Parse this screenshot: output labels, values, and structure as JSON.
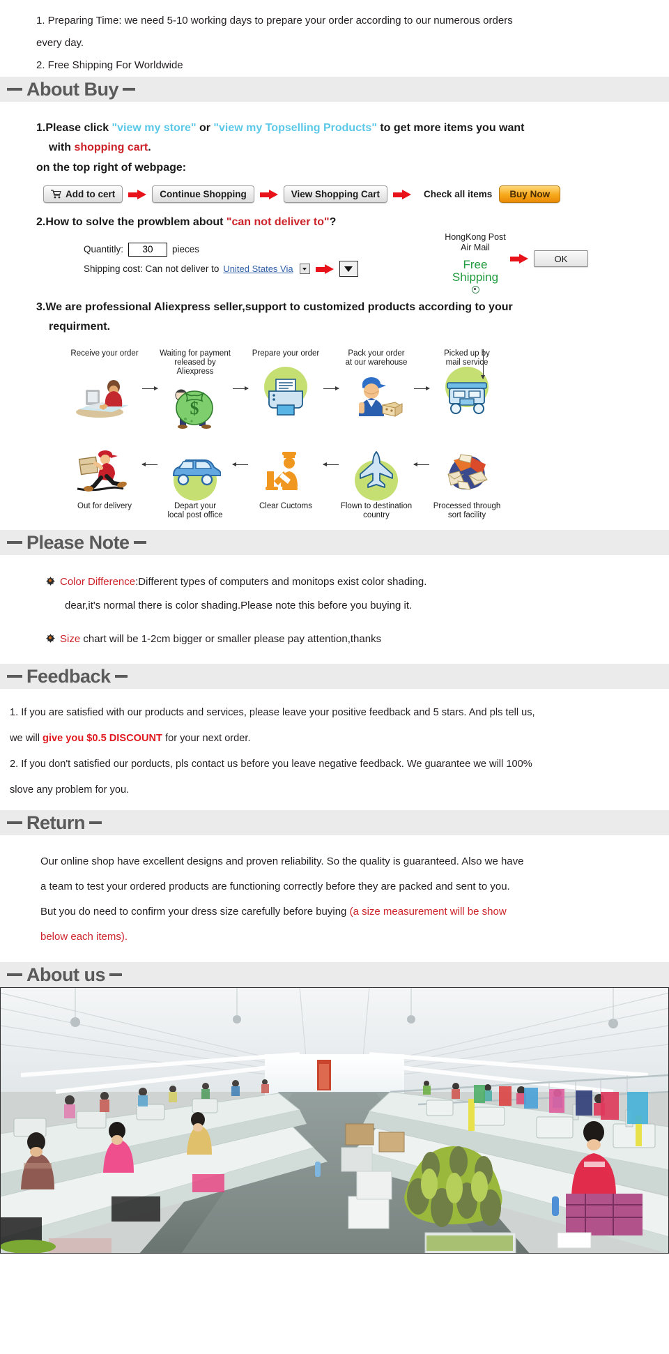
{
  "intro": {
    "line1": "1. Preparing Time: we need 5-10 working days to prepare your order according to our numerous orders",
    "line2": "every day.",
    "line3": "2. Free Shipping For Worldwide"
  },
  "sections": {
    "about_buy": "About Buy",
    "please_note": "Please Note",
    "feedback": "Feedback",
    "return": "Return",
    "about_us": "About us"
  },
  "about_buy": {
    "item1": {
      "prefix": "1.Please click ",
      "link1": "\"view my store\"",
      "mid": " or ",
      "link2": "\"view my Topselling Products\"",
      "suffix": " to get more items you want",
      "line2_prefix": "with ",
      "line2_red": "shopping cart",
      "line2_suffix": ".",
      "line3": "on the top right of webpage:"
    },
    "buttons": {
      "add_to_cart": "Add to cert",
      "continue_shopping": "Continue Shopping",
      "view_shopping_cart": "View Shopping Cart",
      "check_all_items": "Check all items",
      "buy_now": "Buy Now"
    },
    "item2": {
      "prefix": "2.How to solve the prowblem about ",
      "red": "\"can not deliver to\"",
      "suffix": "?"
    },
    "form": {
      "quantity_label": "Quantitly:",
      "quantity_value": "30",
      "quantity_unit": "pieces",
      "shipping_label": "Shipping cost: Can not deliver to",
      "destination": "United States Via",
      "carrier_line1": "HongKong Post",
      "carrier_line2": "Air Mail",
      "free_line1": "Free",
      "free_line2": "Shipping",
      "ok": "OK"
    },
    "item3": {
      "line1": "3.We are professional Aliexpress seller,support to customized products according to your",
      "line2": "requirment."
    },
    "flow_top": [
      {
        "caption": "Receive your order",
        "icon": "person-at-computer-icon"
      },
      {
        "caption": "Waiting for payment\nreleased by Aliexpress",
        "icon": "money-bag-icon"
      },
      {
        "caption": "Prepare your order",
        "icon": "printer-icon"
      },
      {
        "caption": "Pack your order\nat our warehouse",
        "icon": "warehouse-worker-icon"
      },
      {
        "caption": "Picked up by\nmail service",
        "icon": "delivery-truck-icon"
      }
    ],
    "flow_bottom": [
      {
        "caption": "Out for delivery",
        "icon": "running-courier-icon"
      },
      {
        "caption": "Depart your\nlocal post office",
        "icon": "blue-van-icon"
      },
      {
        "caption": "Clear Cuctoms",
        "icon": "customs-officer-icon"
      },
      {
        "caption": "Flown to destination\ncountry",
        "icon": "airplane-icon"
      },
      {
        "caption": "Processed through\nsort facility",
        "icon": "mail-sorting-icon"
      }
    ]
  },
  "please_note": {
    "note1_red": "Color Difference",
    "note1_rest": ":Different types of computers and monitops exist color shading.",
    "note1_line2": "dear,it's normal there is color shading.Please note this before you buying it.",
    "note2_red": "Size",
    "note2_rest": " chart will be 1-2cm bigger or smaller please pay attention,thanks"
  },
  "feedback": {
    "l1": "1. If you are satisfied with our products and services, please leave your positive feedback and 5 stars. And pls tell us,",
    "l2_prefix": "we will ",
    "l2_red": "give you $0.5  DISCOUNT",
    "l2_suffix": " for your next order.",
    "l3": "2. If you don't satisfied our porducts, pls contact us before you leave negative feedback. We guarantee we will 100%",
    "l4": "slove any problem for you."
  },
  "return_section": {
    "l1": "Our online shop have excellent designs and proven reliability. So the quality is guaranteed. Also we have",
    "l2": "a team to test your ordered products are functioning correctly before they are packed and sent to you.",
    "l3_prefix": "But you do need to confirm your dress size carefully before buying ",
    "l3_red": "(a size measurement will be show",
    "l4_red": "below each items)."
  },
  "about_us": {
    "photo_alt": "garment-factory-sewing-floor"
  },
  "colors": {
    "band_bg": "#ebebeb",
    "heading": "#5a5a5a",
    "red": "#cc2229",
    "cyan": "#5bc8e8",
    "green": "#1f9a3d",
    "arrow_red": "#e8131a",
    "buy_now": "#f7a81b"
  }
}
